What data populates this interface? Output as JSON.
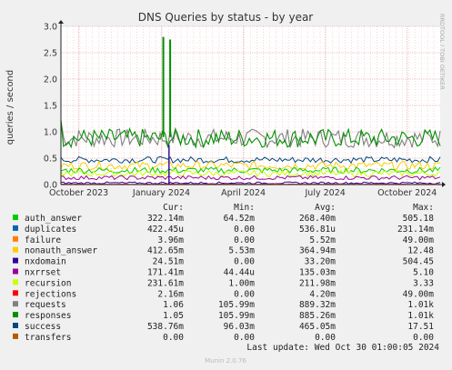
{
  "chart_data": {
    "type": "line",
    "title": "DNS Queries by status - by year",
    "ylabel": "queries / second",
    "side_label": "RRDTOOL / TOBI OETIKER",
    "x_ticks": [
      "October 2023",
      "January 2024",
      "April 2024",
      "July 2024",
      "October 2024"
    ],
    "y_ticks": [
      "0.0",
      "0.5",
      "1.0",
      "1.5",
      "2.0",
      "2.5",
      "3.0"
    ],
    "ylim": [
      0,
      3.0
    ],
    "grid": true,
    "spikes": [
      {
        "series": "requests",
        "x": "January 2024",
        "y": 2.8
      },
      {
        "series": "requests",
        "x": "January 2024",
        "y": 2.75
      }
    ],
    "legend_headers": {
      "cur": "Cur:",
      "min": "Min:",
      "avg": "Avg:",
      "max": "Max:"
    },
    "series": [
      {
        "name": "auth_answer",
        "color": "#00cc00",
        "cur": "322.14m",
        "min": "64.52m",
        "avg": "268.40m",
        "max": "505.18"
      },
      {
        "name": "duplicates",
        "color": "#0066b3",
        "cur": "422.45u",
        "min": "0.00",
        "avg": "536.81u",
        "max": "231.14m"
      },
      {
        "name": "failure",
        "color": "#ff8000",
        "cur": "3.96m",
        "min": "0.00",
        "avg": "5.52m",
        "max": "49.00m"
      },
      {
        "name": "nonauth_answer",
        "color": "#ffcc00",
        "cur": "412.65m",
        "min": "5.53m",
        "avg": "364.94m",
        "max": "12.48"
      },
      {
        "name": "nxdomain",
        "color": "#330099",
        "cur": "24.51m",
        "min": "0.00",
        "avg": "33.20m",
        "max": "504.45"
      },
      {
        "name": "nxrrset",
        "color": "#990099",
        "cur": "171.41m",
        "min": "44.44u",
        "avg": "135.03m",
        "max": "5.10"
      },
      {
        "name": "recursion",
        "color": "#ccff00",
        "cur": "231.61m",
        "min": "1.00m",
        "avg": "211.98m",
        "max": "3.33"
      },
      {
        "name": "rejections",
        "color": "#ff0000",
        "cur": "2.16m",
        "min": "0.00",
        "avg": "4.20m",
        "max": "49.00m"
      },
      {
        "name": "requests",
        "color": "#808080",
        "cur": "1.06",
        "min": "105.99m",
        "avg": "889.32m",
        "max": "1.01k"
      },
      {
        "name": "responses",
        "color": "#008f00",
        "cur": "1.05",
        "min": "105.99m",
        "avg": "885.26m",
        "max": "1.01k"
      },
      {
        "name": "success",
        "color": "#00487d",
        "cur": "538.76m",
        "min": "96.03m",
        "avg": "465.05m",
        "max": "17.51"
      },
      {
        "name": "transfers",
        "color": "#b35a00",
        "cur": "0.00",
        "min": "0.00",
        "avg": "0.00",
        "max": "0.00"
      }
    ],
    "last_update": "Last update: Wed Oct 30 01:00:05 2024",
    "footer": "Munin 2.0.76"
  }
}
